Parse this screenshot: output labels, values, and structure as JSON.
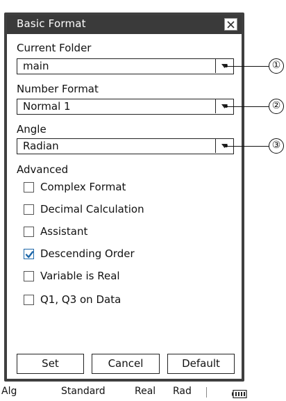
{
  "dialog": {
    "title": "Basic Format",
    "close_label": "×"
  },
  "fields": {
    "current_folder": {
      "label": "Current Folder",
      "value": "main"
    },
    "number_format": {
      "label": "Number Format",
      "value": "Normal 1"
    },
    "angle": {
      "label": "Angle",
      "value": "Radian"
    }
  },
  "advanced": {
    "label": "Advanced",
    "options": [
      {
        "label": "Complex Format",
        "checked": false
      },
      {
        "label": "Decimal Calculation",
        "checked": false
      },
      {
        "label": "Assistant",
        "checked": false
      },
      {
        "label": "Descending Order",
        "checked": true
      },
      {
        "label": "Variable is Real",
        "checked": false
      },
      {
        "label": "Q1, Q3 on Data",
        "checked": false
      }
    ]
  },
  "buttons": {
    "set": "Set",
    "cancel": "Cancel",
    "default": "Default"
  },
  "statusbar": {
    "mode": "Alg",
    "display": "Standard",
    "domain": "Real",
    "angle": "Rad"
  },
  "callouts": [
    "①",
    "②",
    "③"
  ],
  "colors": {
    "titlebar": "#3a3a3a",
    "check_accent": "#1c66a8"
  }
}
